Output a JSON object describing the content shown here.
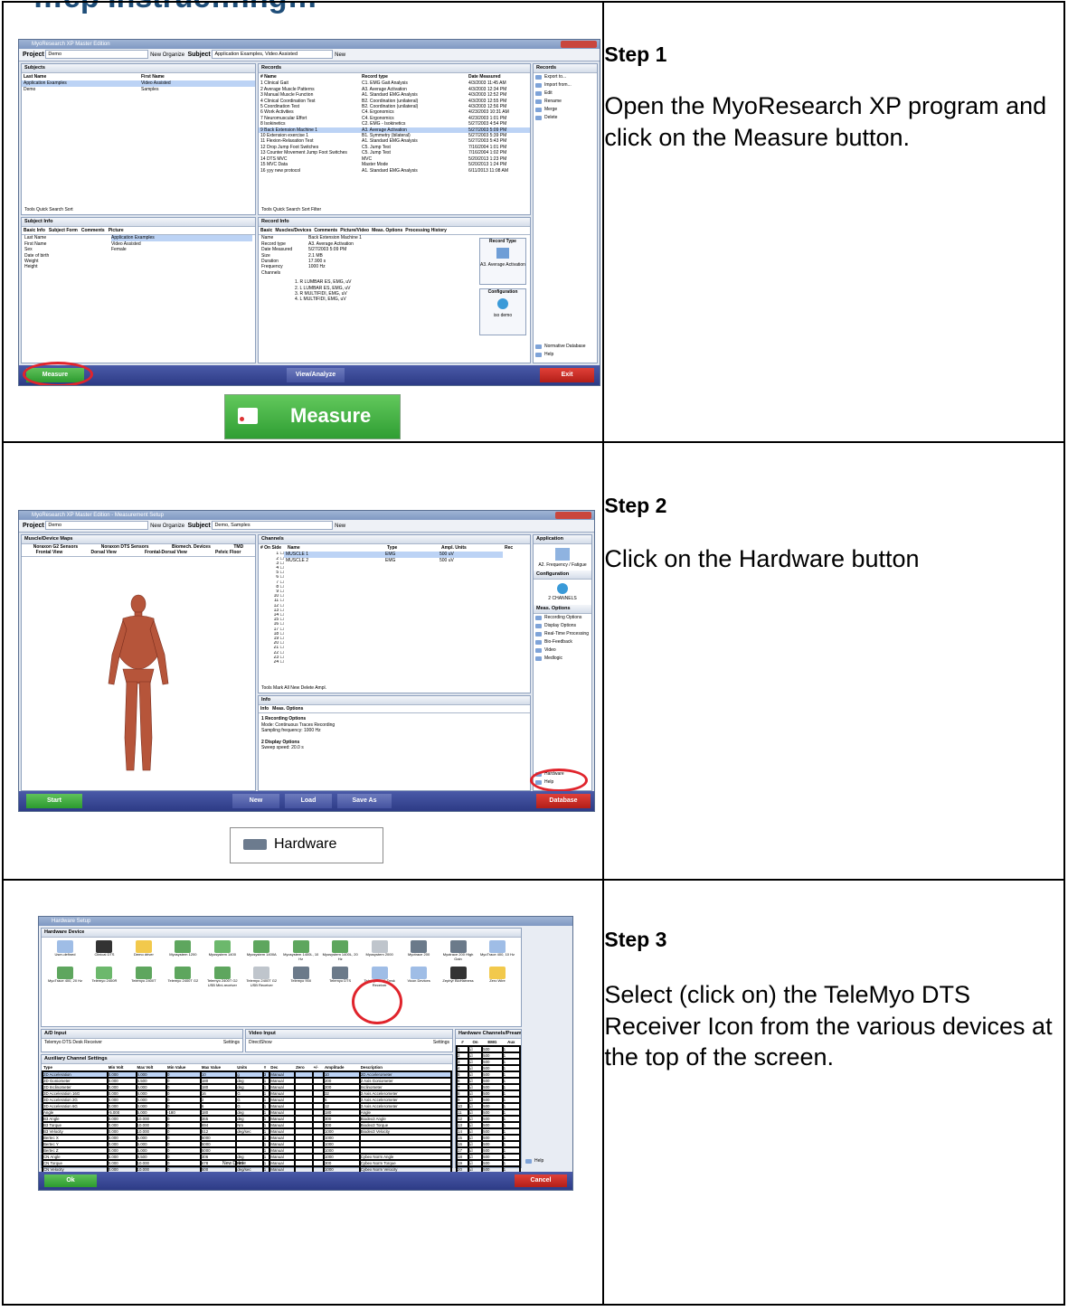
{
  "page": {
    "title_fragment": "…ep Instruc…ing…"
  },
  "steps": [
    {
      "label": "Step 1",
      "description": "Open the MyoResearch XP program and click on the Measure button.",
      "screenshot": {
        "toolbar": {
          "project_label": "Project",
          "project_value": "Demo",
          "new_label": "New",
          "organize_label": "Organize",
          "subject_label": "Subject",
          "subject_value": "Application Examples, Video Assisted",
          "new2_label": "New"
        },
        "subjects_panel": {
          "title": "Subjects",
          "col_last": "Last Name",
          "col_first": "First Name",
          "rows": [
            {
              "last": "Application Examples",
              "first": "Video Assisted"
            },
            {
              "last": "Demo",
              "first": "Samples"
            }
          ]
        },
        "records_panel": {
          "title": "Records",
          "col_name": "# Name",
          "col_type": "Record type",
          "col_date": "Date Measured",
          "rows": [
            {
              "name": "1 Clinical Gait",
              "type": "C1. EMG Gait Analysis",
              "date": "4/3/2003 11:45 AM"
            },
            {
              "name": "2 Average Muscle Patterns",
              "type": "A3. Average Activation",
              "date": "4/3/2003 12:34 PM"
            },
            {
              "name": "3 Manual Muscle Function",
              "type": "A1. Standard EMG Analysis",
              "date": "4/3/2003 12:52 PM"
            },
            {
              "name": "4 Clinical Coordination Test",
              "type": "B2. Coordination (unilateral)",
              "date": "4/3/2003 12:55 PM"
            },
            {
              "name": "5 Coordination Test",
              "type": "B2. Coordination (unilateral)",
              "date": "4/3/2003 12:56 PM"
            },
            {
              "name": "6 Work Activities",
              "type": "C4. Ergonomics",
              "date": "4/23/2003 10:31 AM"
            },
            {
              "name": "7 Neuromuscular Effort",
              "type": "C4. Ergonomics",
              "date": "4/23/2003 1:01 PM"
            },
            {
              "name": "8 Isokinetics",
              "type": "C2. EMG - Isokinetics",
              "date": "5/27/2003 4:54 PM"
            },
            {
              "name": "9 Back Extension Machine 1",
              "type": "A3. Average Activation",
              "date": "5/27/2003 5:09 PM"
            },
            {
              "name": "10 Extension exercise 1",
              "type": "B1. Symmetry (bilateral)",
              "date": "5/27/2003 5:39 PM"
            },
            {
              "name": "11 Flexion-Relaxation Test",
              "type": "A1. Standard EMG Analysis",
              "date": "5/27/2003 5:43 PM"
            },
            {
              "name": "12 Drop Jump Foot Switches",
              "type": "C5. Jump Test",
              "date": "7/16/2004 1:01 PM"
            },
            {
              "name": "13 Counter Movement Jump Foot Switches",
              "type": "C5. Jump Test",
              "date": "7/16/2004 1:02 PM"
            },
            {
              "name": "14 DTS MVC",
              "type": "MVC",
              "date": "5/20/2013 1:23 PM"
            },
            {
              "name": "15 MVC Data",
              "type": "Master Mode",
              "date": "5/20/2013 1:24 PM"
            },
            {
              "name": "16 yyy new protocol",
              "type": "A1. Standard EMG Analysis",
              "date": "6/11/2013 11:08 AM"
            }
          ]
        },
        "records_side": {
          "title": "Records",
          "items": [
            "Export to...",
            "Import from...",
            "Edit",
            "Rename",
            "Merge",
            "Delete"
          ]
        },
        "tools_left": "Tools  Quick Search  Sort",
        "tools_right": "Tools  Quick Search  Sort  Filter",
        "subject_info": {
          "title": "Subject Info",
          "tabs": [
            "Basic Info",
            "Subject Form",
            "Comments",
            "Picture"
          ],
          "fields": [
            {
              "k": "Last Name",
              "v": "Application Examples"
            },
            {
              "k": "First Name",
              "v": "Video Assisted"
            },
            {
              "k": "Sex",
              "v": "Female"
            },
            {
              "k": "Date of birth",
              "v": ""
            },
            {
              "k": "Weight",
              "v": ""
            },
            {
              "k": "Height",
              "v": ""
            }
          ]
        },
        "record_info": {
          "title": "Record Info",
          "tabs": [
            "Basic",
            "Muscles/Devices",
            "Comments",
            "Picture/Video",
            "Meas. Options",
            "Processing History"
          ],
          "fields": [
            {
              "k": "Name",
              "v": "Back Extension Machine 1"
            },
            {
              "k": "Record type",
              "v": "A3. Average Activation"
            },
            {
              "k": "Date Measured",
              "v": "5/27/2003 5:09 PM"
            },
            {
              "k": "Size",
              "v": "2.1 MB"
            },
            {
              "k": "Duration",
              "v": "17.900 s"
            },
            {
              "k": "Frequency",
              "v": "1000 Hz"
            },
            {
              "k": "Channels",
              "v": ""
            }
          ],
          "channels": [
            "1. R LUMBAR ES, EMG, uV",
            "2. L LUMBAR ES, EMG, uV",
            "3. R MULTIFIDI, EMG, uV",
            "4. L MULTIFIDI, EMG, uV"
          ],
          "record_type_title": "Record Type",
          "record_type_value": "A3. Average Activation",
          "configuration_title": "Configuration",
          "configuration_value": "iso demo"
        },
        "side_bottom": [
          "Normative Database",
          "Help"
        ],
        "buttons": {
          "measure": "Measure",
          "view": "View/Analyze",
          "exit": "Exit"
        },
        "callout_label": "Measure"
      }
    },
    {
      "label": "Step 2",
      "description": "Click on the Hardware button",
      "screenshot": {
        "toolbar": {
          "project_label": "Project",
          "project_value": "Demo",
          "new_label": "New",
          "organize_label": "Organize",
          "subject_label": "Subject",
          "subject_value": "Demo, Samples",
          "new2_label": "New"
        },
        "maps_panel": {
          "title": "Muscle/Device Maps",
          "tabs_row1": [
            "Noraxon G2 Sensors",
            "Noraxon DTS Sensors",
            "Biomech. Devices",
            "TMD"
          ],
          "tabs_row2": [
            "Frontal View",
            "Dorsal View",
            "Frontal-Dorsal View",
            "Pelvic Floor"
          ]
        },
        "channels_panel": {
          "title": "Channels",
          "col_num": "# On Side",
          "col_name": "Name",
          "col_type": "Type",
          "col_units": "Ampl. Units",
          "col_rec": "Rec",
          "rows": [
            {
              "name": "MUSCLE 1",
              "type": "EMG",
              "units": "500 uV"
            },
            {
              "name": "MUSCLE 2",
              "type": "EMG",
              "units": "500 uV"
            }
          ],
          "numbers": [
            "1",
            "2",
            "3",
            "4",
            "5",
            "6",
            "7",
            "8",
            "9",
            "10",
            "11",
            "12",
            "13",
            "14",
            "15",
            "16",
            "17",
            "18",
            "19",
            "20",
            "21",
            "22",
            "23",
            "24"
          ]
        },
        "tools": "Tools  Mark All  New  Delete  Ampl.",
        "info_panel": {
          "title": "Info",
          "tabs": [
            "Info",
            "Meas. Options"
          ],
          "lines": [
            "1 Recording Options",
            "Mode: Continuous Traces Recording",
            "Sampling frequency: 1000 Hz",
            "",
            "2 Display Options",
            "Sweep speed: 20.0 s"
          ]
        },
        "side": {
          "application_title": "Application",
          "application_value": "A2. Frequency / Fatigue",
          "configuration_title": "Configuration",
          "configuration_value": "2 CHANNELS",
          "meas_title": "Meas. Options",
          "meas_items": [
            "Recording Options",
            "Display Options",
            "Real-Time Processing",
            "Bio-Feedback",
            "Video",
            "Medlogic"
          ],
          "bottom_items": [
            "Hardware",
            "Help"
          ]
        },
        "buttons": {
          "start": "Start",
          "new": "New",
          "load": "Load",
          "save_as": "Save As",
          "database": "Database"
        },
        "callout_label": "Hardware"
      }
    },
    {
      "label": "Step 3",
      "description": "Select (click on) the TeleMyo DTS Receiver Icon from the various devices at the top of the screen.",
      "screenshot": {
        "window_title": "Hardware Setup",
        "device_panel_title": "Hardware Device",
        "devices_row1": [
          "User-defined",
          "Clinical DTS",
          "Demo driver",
          "Myosystem 1200",
          "Myosystem 1400",
          "Myosystem 1400A",
          "Myosystem 1400L, 10 Hz",
          "Myosystem 1400L, 20 Hz",
          "Myosystem 2000",
          "Myotrace 200",
          "Myotrace 200 High Gain",
          "MyoTrace 400, 10 Hz"
        ],
        "devices_row2": [
          "MyoTrace 400, 20 Hz",
          "Telemyo 2400R",
          "Telemyo 2400T",
          "Telemyo 2400T G2",
          "Telemyo 2400T G2 USB Mini-receiver",
          "Telemyo 2400T G2 USB Receiver",
          "Telemyo 900",
          "Telemyo DTS",
          "Telemyo DTS Desk Receiver",
          "Vicon Devices",
          "Zephyr BioHarness",
          "Zero Wire"
        ],
        "ad_input": {
          "title": "A/D Input",
          "value": "Telemyo DTS Desk Receiver",
          "settings": "Settings"
        },
        "video_input": {
          "title": "Video Input",
          "value": "DirectShow",
          "settings": "Settings"
        },
        "aux_title": "Auxiliary Channel Settings",
        "aux_headers": [
          "Type",
          "Min Volt",
          "Max Volt",
          "Min Value",
          "Max Value",
          "Units",
          "#",
          "Dec",
          "Zero",
          "+/-",
          "Amplitude",
          "Description"
        ],
        "aux_rows": [
          [
            "2D Acceleration",
            "0.000",
            "4.000",
            "0",
            "10",
            "g",
            "3",
            "Manual",
            "",
            "",
            "10",
            "2D Accelerometer"
          ],
          [
            "2D Goniometer",
            "0.000",
            "4.500",
            "0",
            "180",
            "deg",
            "1",
            "Manual",
            "",
            "",
            "200",
            "2 Axis Goniometer"
          ],
          [
            "2D Inclinometer",
            "0.000",
            "4.000",
            "0",
            "180",
            "deg",
            "1",
            "Manual",
            "",
            "",
            "200",
            "Inclinometer"
          ],
          [
            "3D Acceleration 16G",
            "0.000",
            "4.000",
            "0",
            "16",
            "G",
            "1",
            "Manual",
            "",
            "",
            "32",
            "3 Axis Accelerometer"
          ],
          [
            "3D Acceleration 2G",
            "0.000",
            "4.000",
            "0",
            "2",
            "G",
            "1",
            "Manual",
            "",
            "",
            "6",
            "3 Axis Accelerometer"
          ],
          [
            "3D Acceleration 6G",
            "0.000",
            "4.000",
            "0",
            "6",
            "G",
            "1",
            "Manual",
            "",
            "",
            "12",
            "3 Axis Accelerometer"
          ],
          [
            "Angle",
            "-5.000",
            "5.000",
            "-180",
            "180",
            "deg",
            "1",
            "Manual",
            "",
            "",
            "180",
            "Angle"
          ],
          [
            "B3 Angle",
            "0.000",
            "10.000",
            "0",
            "365",
            "deg",
            "1",
            "Manual",
            "",
            "",
            "300",
            "Biodex3 Angle"
          ],
          [
            "B3 Torque",
            "0.000",
            "10.000",
            "0",
            "694",
            "Nm",
            "1",
            "Manual",
            "",
            "",
            "300",
            "Biodex3 Torque"
          ],
          [
            "B3 Velocity",
            "0.000",
            "10.000",
            "0",
            "512",
            "deg/sec",
            "1",
            "Manual",
            "",
            "",
            "1000",
            "Biodex3 Velocity"
          ],
          [
            "Bertec X",
            "0.000",
            "5.000",
            "0",
            "5000",
            "",
            "1",
            "Manual",
            "",
            "",
            "1000",
            ""
          ],
          [
            "Bertec Y",
            "0.000",
            "5.000",
            "0",
            "5000",
            "",
            "1",
            "Manual",
            "",
            "",
            "1000",
            ""
          ],
          [
            "Bertec Z",
            "0.000",
            "5.000",
            "0",
            "5000",
            "",
            "1",
            "Manual",
            "",
            "",
            "1000",
            ""
          ],
          [
            "CN Angle",
            "0.000",
            "8.500",
            "0",
            "306",
            "deg",
            "1",
            "Manual",
            "",
            "",
            "1000",
            "Cybex Norm Angle"
          ],
          [
            "CN Torque",
            "0.000",
            "10.000",
            "0",
            "678",
            "Nm",
            "1",
            "Manual",
            "",
            "",
            "300",
            "Cybex Norm Torque"
          ],
          [
            "CN Velocity",
            "0.000",
            "10.000",
            "0",
            "500",
            "deg/sec",
            "1",
            "Manual",
            "",
            "",
            "1000",
            "Cybex Norm Velocity"
          ],
          [
            "Con-Trex Angle",
            "0.000",
            "5.000",
            "0",
            "5000",
            "deg",
            "1",
            "Manual",
            "",
            "",
            "1000",
            "Cal. Data need to be entered!"
          ],
          [
            "Con-Trex Torque",
            "0.000",
            "5.000",
            "0",
            "5000",
            "Nm",
            "1",
            "Manual",
            "",
            "",
            "1000",
            "Cal. Data need to be entered!"
          ],
          [
            "Contact",
            "0.000",
            "5.000",
            "0",
            "5000",
            "On/Off",
            "1",
            "Manual",
            "",
            "",
            "5000",
            "Contact Plate"
          ]
        ],
        "aux_footer": "New  Delete",
        "hw_title": "Hardware Channels/Preamps",
        "hw_headers": [
          "#",
          "On",
          "EMG",
          "Aux"
        ],
        "hw_rows": [
          "1",
          "2",
          "3",
          "4",
          "5",
          "6",
          "7",
          "8",
          "9",
          "10",
          "11",
          "12",
          "13",
          "14",
          "15",
          "16",
          "17",
          "18",
          "19",
          "20",
          "21",
          "22",
          "23",
          "24"
        ],
        "hw_emg": "500",
        "hw_aux": "1",
        "help": "Help",
        "buttons": {
          "ok": "Ok",
          "cancel": "Cancel"
        }
      }
    }
  ]
}
